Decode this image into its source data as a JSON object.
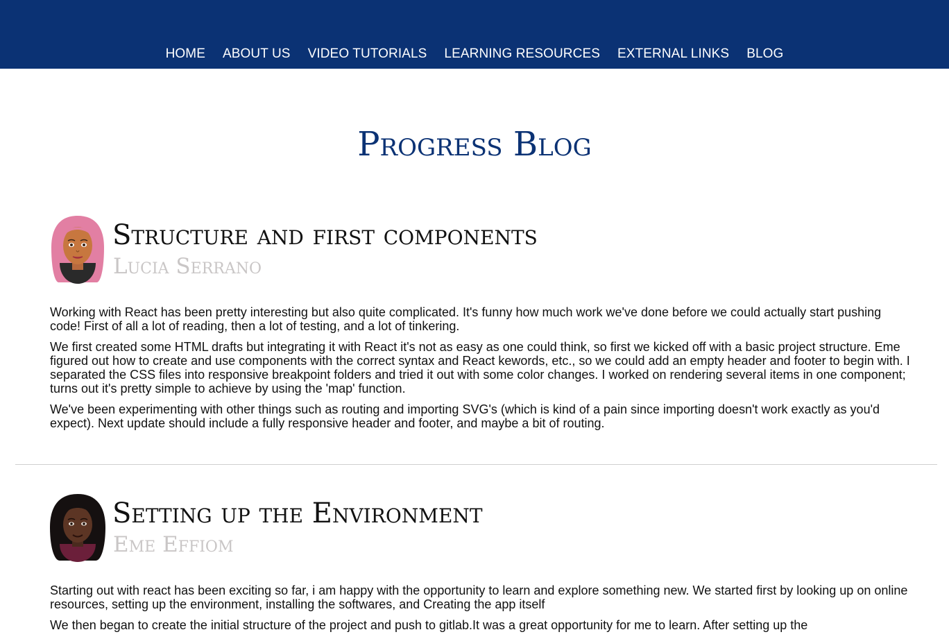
{
  "nav": {
    "items": [
      {
        "label": "HOME"
      },
      {
        "label": "ABOUT US"
      },
      {
        "label": "VIDEO TUTORIALS"
      },
      {
        "label": "LEARNING RESOURCES"
      },
      {
        "label": "EXTERNAL LINKS"
      },
      {
        "label": "BLOG"
      }
    ]
  },
  "page": {
    "title": "Progress Blog"
  },
  "posts": [
    {
      "title": "Structure and first components",
      "author": "Lucia Serrano",
      "avatar_icon": "woman-avatar-pink-hair-icon",
      "paragraphs": [
        "Working with React has been pretty interesting but also quite complicated. It's funny how much work we've done before we could actually start pushing code! First of all a lot of reading, then a lot of testing, and a lot of tinkering.",
        "We first created some HTML drafts but integrating it with React it's not as easy as one could think, so first we kicked off with a basic project structure. Eme figured out how to create and use components with the correct syntax and React kewords, etc., so we could add an empty header and footer to begin with. I separated the CSS files into responsive breakpoint folders and tried it out with some color changes. I worked on rendering several items in one component; turns out it's pretty simple to achieve by using the 'map' function.",
        "We've been experimenting with other things such as routing and importing SVG's (which is kind of a pain since importing doesn't work exactly as you'd expect). Next update should include a fully responsive header and footer, and maybe a bit of routing."
      ]
    },
    {
      "title": "Setting up the Environment",
      "author": "Eme Effiom",
      "avatar_icon": "woman-avatar-black-hair-icon",
      "paragraphs": [
        "Starting out with react has been exciting so far, i am happy with the opportunity to learn and explore something new. We started first by looking up on online resources, setting up the environment, installing the softwares, and Creating the app itself",
        "We then began to create the initial structure of the project and push to gitlab.It was a great opportunity for me to learn. After setting up the"
      ]
    }
  ],
  "colors": {
    "header_bg": "#0b3274",
    "title": "#0b3274",
    "author": "#c9c6c6"
  }
}
